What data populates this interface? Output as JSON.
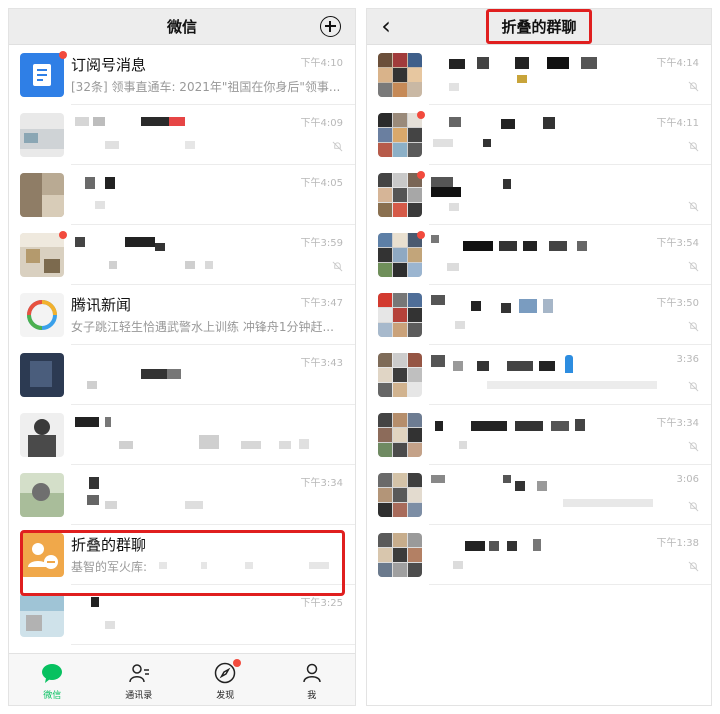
{
  "left": {
    "title": "微信",
    "chats": [
      {
        "name": "订阅号消息",
        "message": "[32条] 领事直通车: 2021年\"祖国在你身后\"领事...",
        "time": "下午4:10",
        "badge": true,
        "muted": false,
        "avatar_icon": "subscription-icon"
      },
      {
        "name": "",
        "message": "",
        "time": "下午4:09",
        "badge": false,
        "muted": true
      },
      {
        "name": "",
        "message": "",
        "time": "下午4:05",
        "badge": false,
        "muted": false
      },
      {
        "name": "",
        "message": "",
        "time": "下午3:59",
        "badge": true,
        "muted": true
      },
      {
        "name": "腾讯新闻",
        "message": "女子跳江轻生恰遇武警水上训练 冲锋舟1分钟赶...",
        "time": "下午3:47",
        "badge": false,
        "muted": false,
        "avatar_icon": "tencent-news-icon"
      },
      {
        "name": "",
        "message": "",
        "time": "下午3:43",
        "badge": false,
        "muted": false
      },
      {
        "name": "",
        "message": "",
        "time": "",
        "badge": false,
        "muted": false
      },
      {
        "name": "",
        "message": "",
        "time": "下午3:34",
        "badge": false,
        "muted": false
      },
      {
        "name": "折叠的群聊",
        "message": "基智的军火库:",
        "time": "",
        "badge": false,
        "muted": false,
        "avatar_icon": "folded-group-icon"
      },
      {
        "name": "",
        "message": "",
        "time": "下午3:25",
        "badge": false,
        "muted": false
      }
    ],
    "tabs": [
      {
        "label": "微信",
        "icon": "chat-bubble-icon",
        "active": true,
        "dot": false
      },
      {
        "label": "通讯录",
        "icon": "contacts-icon",
        "active": false,
        "dot": false
      },
      {
        "label": "发现",
        "icon": "compass-icon",
        "active": false,
        "dot": true
      },
      {
        "label": "我",
        "icon": "person-icon",
        "active": false,
        "dot": false
      }
    ]
  },
  "right": {
    "title": "折叠的群聊",
    "back_icon": "chevron-left-icon",
    "groups": [
      {
        "time": "下午4:14",
        "badge": false,
        "muted": true
      },
      {
        "time": "下午4:11",
        "badge": true,
        "muted": true
      },
      {
        "time": "",
        "badge": true,
        "muted": true
      },
      {
        "time": "下午3:54",
        "badge": true,
        "muted": true
      },
      {
        "time": "下午3:50",
        "badge": false,
        "muted": true
      },
      {
        "time": "3:36",
        "badge": false,
        "muted": true
      },
      {
        "time": "下午3:34",
        "badge": false,
        "muted": true
      },
      {
        "time": "3:06",
        "badge": false,
        "muted": true
      },
      {
        "time": "下午1:38",
        "badge": false,
        "muted": true
      }
    ]
  },
  "colors": {
    "accent_green": "#07c160",
    "highlight_red": "#e01f1f",
    "badge_red": "#f24a3d"
  }
}
